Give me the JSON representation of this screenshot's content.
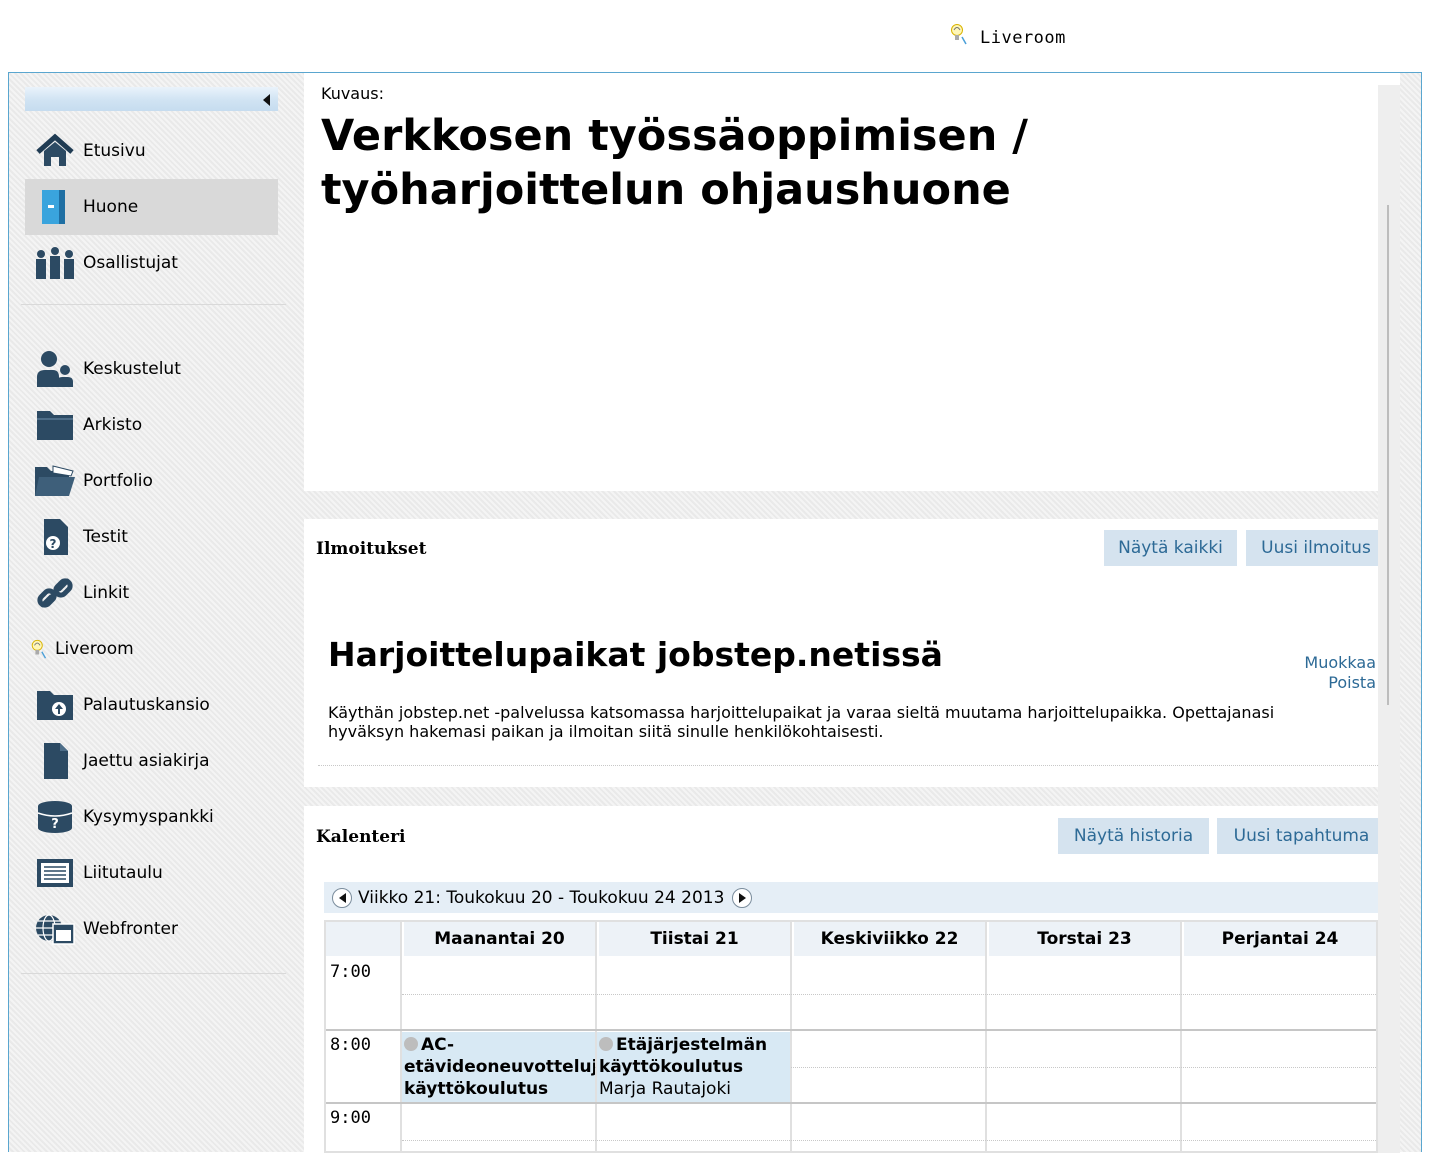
{
  "header": {
    "liveroom_label": "Liveroom"
  },
  "sidebar": {
    "items": [
      {
        "label": "Etusivu",
        "icon": "home-icon"
      },
      {
        "label": "Huone",
        "icon": "door-icon",
        "active": true
      },
      {
        "label": "Osallistujat",
        "icon": "people-icon"
      },
      {
        "label": "Keskustelut",
        "icon": "discussion-icon"
      },
      {
        "label": "Arkisto",
        "icon": "folder-icon"
      },
      {
        "label": "Portfolio",
        "icon": "open-folder-icon"
      },
      {
        "label": "Testit",
        "icon": "test-document-icon"
      },
      {
        "label": "Linkit",
        "icon": "link-icon"
      },
      {
        "label": "Liveroom",
        "icon": "lightbulb-icon"
      },
      {
        "label": "Palautuskansio",
        "icon": "upload-folder-icon"
      },
      {
        "label": "Jaettu asiakirja",
        "icon": "document-icon"
      },
      {
        "label": "Kysymyspankki",
        "icon": "question-bank-icon"
      },
      {
        "label": "Liitutaulu",
        "icon": "whiteboard-icon"
      },
      {
        "label": "Webfronter",
        "icon": "globe-window-icon"
      }
    ]
  },
  "description": {
    "label": "Kuvaus:",
    "title": "Verkkosen työssäoppimisen / työharjoittelun ohjaushuone"
  },
  "announcements": {
    "title": "Ilmoitukset",
    "show_all": "Näytä kaikki",
    "new": "Uusi ilmoitus",
    "item": {
      "title": "Harjoittelupaikat jobstep.netissä",
      "body": "Käythän jobstep.net -palvelussa katsomassa harjoittelupaikat ja varaa sieltä muutama harjoittelupaikka. Opettajanasi hyväksyn hakemasi paikan ja ilmoitan siitä sinulle henkilökohtaisesti.",
      "edit": "Muokkaa",
      "delete": "Poista"
    }
  },
  "calendar": {
    "title": "Kalenteri",
    "show_history": "Näytä historia",
    "new_event": "Uusi tapahtuma",
    "week_label": "Viikko 21: Toukokuu 20 - Toukokuu 24 2013",
    "days": [
      "Maanantai 20",
      "Tiistai 21",
      "Keskiviikko 22",
      "Torstai 23",
      "Perjantai 24"
    ],
    "hours": [
      "7:00",
      "8:00",
      "9:00"
    ],
    "events": [
      {
        "title_line1": "AC-",
        "title_line2": "etävideoneuvottelujärjestelmän",
        "title_line3": "käyttökoulutus",
        "day_index": 0,
        "time": "8:00"
      },
      {
        "title_line1": "Etäjärjestelmän",
        "title_line2": "käyttökoulutus",
        "person": "Marja Rautajoki",
        "day_index": 1,
        "time": "8:00"
      }
    ]
  }
}
